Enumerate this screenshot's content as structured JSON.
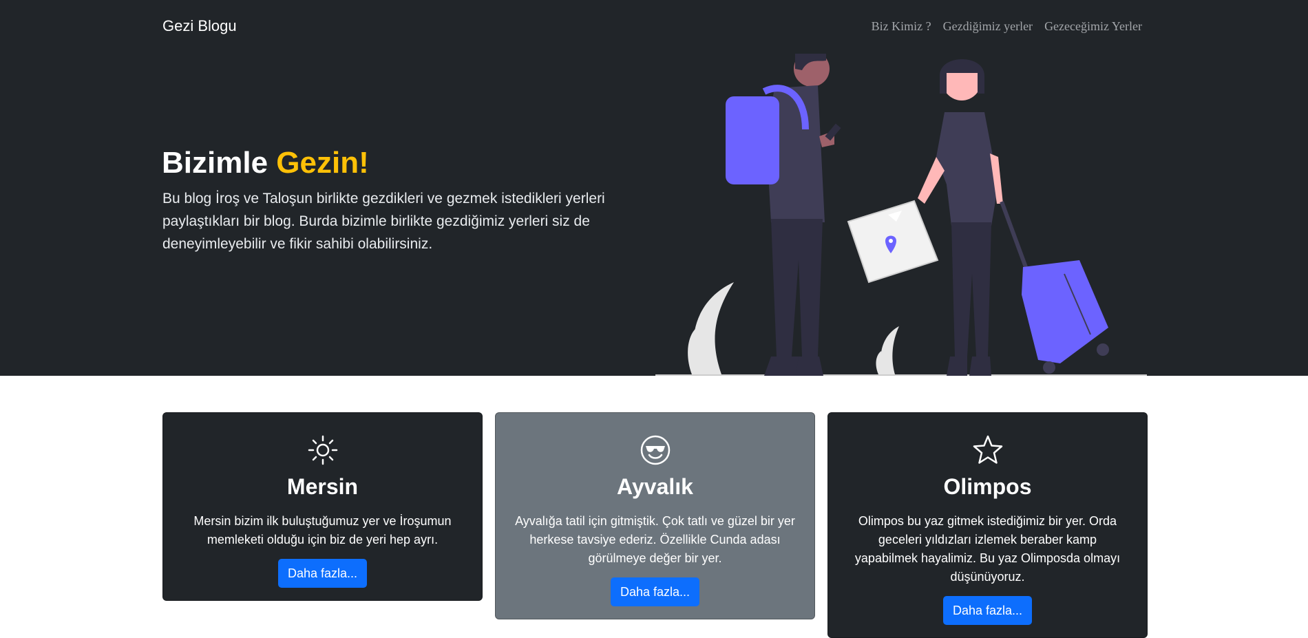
{
  "navbar": {
    "brand": "Gezi Blogu",
    "links": [
      "Biz Kimiz ?",
      "Gezdiğimiz yerler",
      "Gezeceğimiz Yerler"
    ]
  },
  "hero": {
    "title_main": "Bizimle",
    "title_accent": "Gezin!",
    "lead": "Bu blog İroş ve Taloşun birlikte gezdikleri ve gezmek istedikleri yerleri paylaştıkları bir blog. Burda bizimle birlikte gezdiğimiz yerleri siz de deneyimleyebilir ve fikir sahibi olabilirsiniz."
  },
  "cards": [
    {
      "icon": "sun-icon",
      "title": "Mersin",
      "text": "Mersin bizim ilk buluştuğumuz yer ve İroşumun memleketi olduğu için biz de yeri hep ayrı.",
      "button": "Daha fazla..."
    },
    {
      "icon": "sunglasses-smiley-icon",
      "title": "Ayvalık",
      "text": "Ayvalığa tatil için gitmiştik. Çok tatlı ve güzel bir yer herkese tavsiye ederiz. Özellikle Cunda adası görülmeye değer bir yer.",
      "button": "Daha fazla..."
    },
    {
      "icon": "star-icon",
      "title": "Olimpos",
      "text": "Olimpos bu yaz gitmek istediğimiz bir yer. Orda geceleri yıldızları izlemek beraber kamp yapabilmek hayalimiz. Bu yaz Olimposda olmayı düşünüyoruz.",
      "button": "Daha fazla..."
    }
  ],
  "colors": {
    "hero_bg": "#212529",
    "accent": "#ffc107",
    "card_gray": "#6c757d",
    "button": "#0d6efd",
    "illustration_purple": "#6c63ff"
  }
}
